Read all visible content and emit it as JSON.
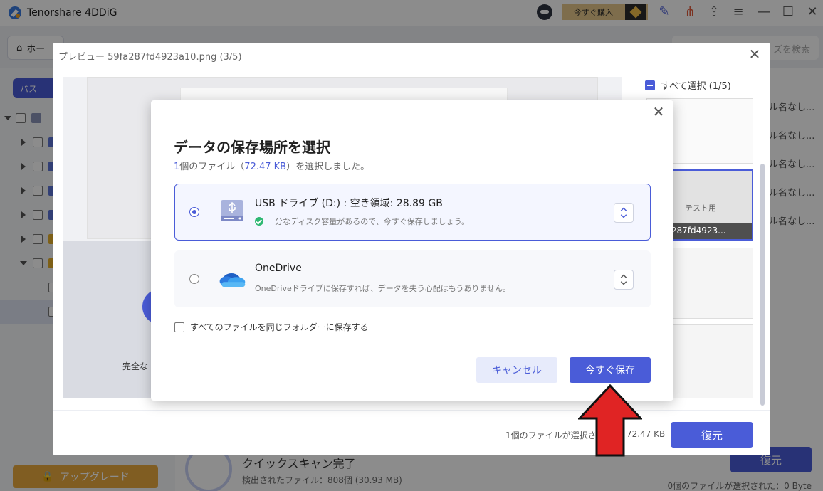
{
  "app": {
    "name": "Tenorshare 4DDiG",
    "buy_label": "今すぐ購入",
    "home_tab": "ホー",
    "search_placeholder": "ズを検索",
    "path_tab": "パス",
    "upgrade_label": "アップグレード",
    "scan_title": "クイックスキャン完了",
    "scan_detected": "検出されたファイル：808個 (30.93 MB)",
    "restore_label": "復元",
    "selected_status": "0個のファイルが選択された：0 Byte",
    "right_list": [
      "ル名なし...",
      "ル名なし...",
      "ル名なし...",
      "ル名なし...",
      "ル名なし..."
    ]
  },
  "preview": {
    "title": "プレビュー 59fa287fd4923a10.png (3/5)",
    "done_label": "完全な",
    "select_all": "すべて選択 (1/5)",
    "thumb_caption": "59fa287fd4923...",
    "thumb_text": "テスト用",
    "footer_text": "1個のファイルが選択さ",
    "footer_size": "72.47 KB",
    "restore_label": "復元"
  },
  "modal": {
    "title": "データの保存場所を選択",
    "sub_count": "1",
    "sub_before": "個のファイル（",
    "sub_size": "72.47 KB",
    "sub_after": "）を選択しました。",
    "options": [
      {
        "name": "USB ドライブ (D:) : 空き領域:  28.89 GB",
        "desc": "十分なディスク容量があるので、今すぐ保存しましょう。",
        "selected": true,
        "icon": "usb-drive-icon"
      },
      {
        "name": "OneDrive",
        "desc": "OneDriveドライブに保存すれば、データを失う心配はもうありません。",
        "selected": false,
        "icon": "onedrive-cloud-icon"
      }
    ],
    "same_folder_label": "すべてのファイルを同じフォルダーに保存する",
    "cancel_label": "キャンセル",
    "save_label": "今すぐ保存"
  },
  "colors": {
    "accent": "#4a5cd8",
    "annotation_arrow": "#e02424"
  }
}
